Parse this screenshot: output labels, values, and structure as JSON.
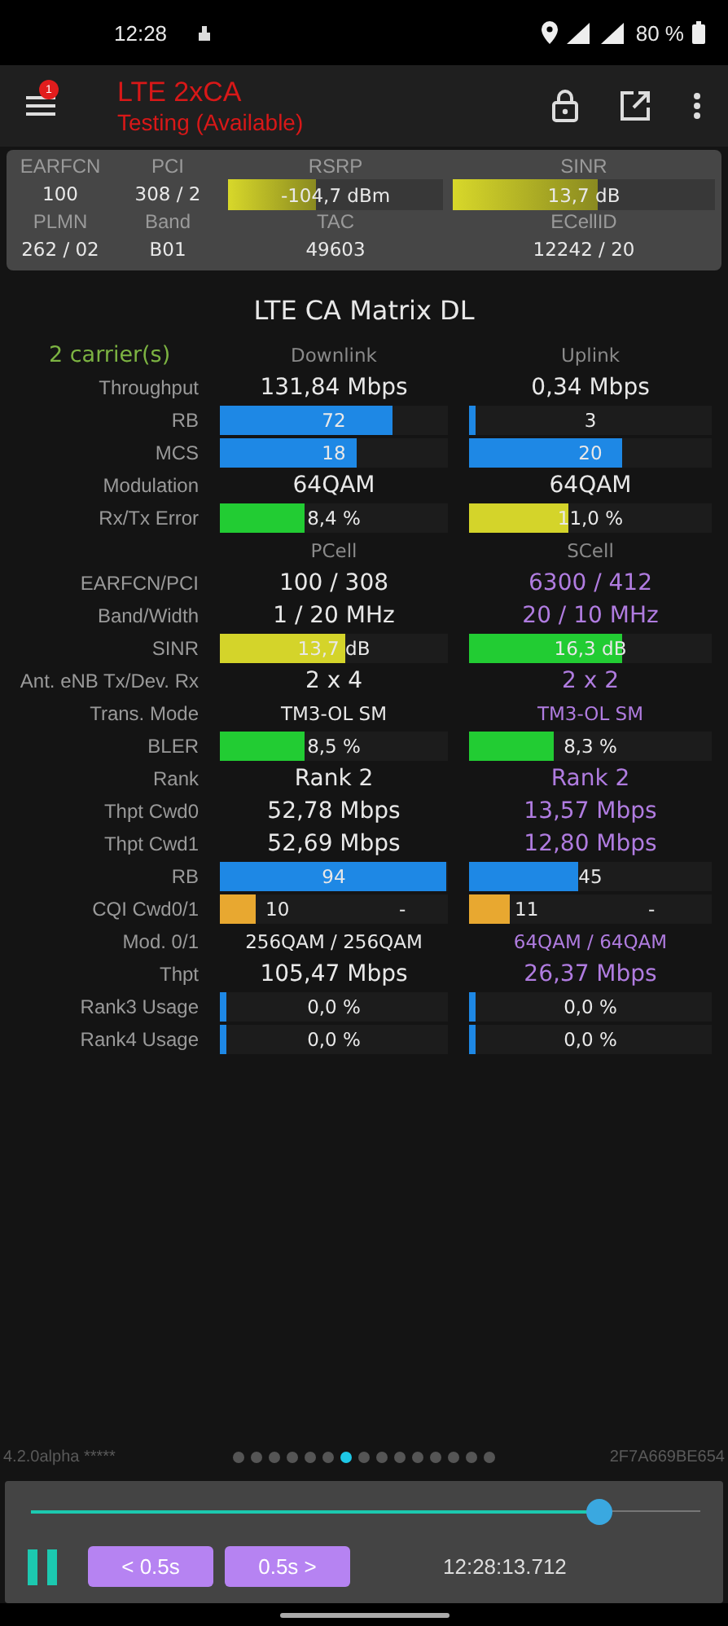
{
  "status_bar": {
    "time": "12:28",
    "battery": "80 %"
  },
  "app_bar": {
    "badge": "1",
    "title": "LTE 2xCA",
    "subtitle": "Testing (Available)"
  },
  "info_panel": {
    "row1": [
      {
        "label": "EARFCN",
        "value": "100",
        "kind": "text"
      },
      {
        "label": "PCI",
        "value": "308 / 2",
        "kind": "text"
      },
      {
        "label": "RSRP",
        "value": "-104,7 dBm",
        "kind": "bar",
        "level": 0.41
      },
      {
        "label": "SINR",
        "value": "13,7 dB",
        "kind": "bar",
        "level": 0.55
      }
    ],
    "row2": [
      {
        "label": "PLMN",
        "value": "262 / 02"
      },
      {
        "label": "Band",
        "value": "B01"
      },
      {
        "label": "TAC",
        "value": "49603"
      },
      {
        "label": "ECellID",
        "value": "12242 / 20"
      }
    ]
  },
  "matrix": {
    "title": "LTE CA Matrix DL",
    "rows": [
      {
        "kind": "header",
        "label": "2 carrier(s)",
        "cells": [
          {
            "text": "Downlink"
          },
          {
            "text": "Uplink"
          }
        ]
      },
      {
        "kind": "value",
        "label": "Throughput",
        "cells": [
          {
            "text": "131,84 Mbps",
            "color": "#e8e8e8"
          },
          {
            "text": "0,34 Mbps",
            "color": "#e8e8e8"
          }
        ]
      },
      {
        "kind": "bar",
        "label": "RB",
        "cells": [
          {
            "text": "72",
            "level": 0.76,
            "color": "#1e88e5"
          },
          {
            "text": "3",
            "level": 0.02,
            "color": "#1e88e5"
          }
        ]
      },
      {
        "kind": "bar",
        "label": "MCS",
        "cells": [
          {
            "text": "18",
            "level": 0.6,
            "color": "#1e88e5"
          },
          {
            "text": "20",
            "level": 0.63,
            "color": "#1e88e5"
          }
        ]
      },
      {
        "kind": "value",
        "label": "Modulation",
        "cells": [
          {
            "text": "64QAM",
            "color": "#e8e8e8"
          },
          {
            "text": "64QAM",
            "color": "#e8e8e8"
          }
        ]
      },
      {
        "kind": "bar",
        "label": "Rx/Tx Error",
        "cells": [
          {
            "text": "8,4 %",
            "level": 0.37,
            "color": "#22cc33"
          },
          {
            "text": "11,0 %",
            "level": 0.41,
            "color": "#d4d42a"
          }
        ]
      },
      {
        "kind": "header",
        "cells": [
          {
            "text": "PCell"
          },
          {
            "text": "SCell"
          }
        ]
      },
      {
        "kind": "value",
        "label": "EARFCN/PCI",
        "cells": [
          {
            "text": "100 / 308",
            "color": "#e8e8e8"
          },
          {
            "text": "6300 / 412",
            "color": "#b07ce0"
          }
        ]
      },
      {
        "kind": "value",
        "label": "Band/Width",
        "cells": [
          {
            "text": "1 / 20 MHz",
            "color": "#e8e8e8"
          },
          {
            "text": "20 / 10 MHz",
            "color": "#b07ce0"
          }
        ]
      },
      {
        "kind": "bar",
        "label": "SINR",
        "cells": [
          {
            "text": "13,7 dB",
            "level": 0.55,
            "color": "#d4d42a"
          },
          {
            "text": "16,3 dB",
            "level": 0.63,
            "color": "#22cc33"
          }
        ]
      },
      {
        "kind": "value",
        "label": "Ant. eNB Tx/Dev. Rx",
        "cells": [
          {
            "text": "2 x 4",
            "color": "#e8e8e8"
          },
          {
            "text": "2 x 2",
            "color": "#b07ce0"
          }
        ]
      },
      {
        "kind": "small",
        "label": "Trans. Mode",
        "cells": [
          {
            "text": "TM3-OL SM",
            "color": "#e8e8e8"
          },
          {
            "text": "TM3-OL SM",
            "color": "#b07ce0"
          }
        ]
      },
      {
        "kind": "bar",
        "label": "BLER",
        "cells": [
          {
            "text": "8,5 %",
            "level": 0.37,
            "color": "#22cc33"
          },
          {
            "text": "8,3 %",
            "level": 0.35,
            "color": "#22cc33"
          }
        ]
      },
      {
        "kind": "value",
        "label": "Rank",
        "cells": [
          {
            "text": "Rank 2",
            "color": "#e8e8e8"
          },
          {
            "text": "Rank 2",
            "color": "#b07ce0"
          }
        ]
      },
      {
        "kind": "value",
        "label": "Thpt Cwd0",
        "cells": [
          {
            "text": "52,78 Mbps",
            "color": "#e8e8e8"
          },
          {
            "text": "13,57 Mbps",
            "color": "#b07ce0"
          }
        ]
      },
      {
        "kind": "value",
        "label": "Thpt Cwd1",
        "cells": [
          {
            "text": "52,69 Mbps",
            "color": "#e8e8e8"
          },
          {
            "text": "12,80 Mbps",
            "color": "#b07ce0"
          }
        ]
      },
      {
        "kind": "bar",
        "label": "RB",
        "cells": [
          {
            "text": "94",
            "level": 0.99,
            "color": "#1e88e5"
          },
          {
            "text": "45",
            "level": 0.45,
            "color": "#1e88e5"
          }
        ]
      },
      {
        "kind": "cqi",
        "label": "CQI Cwd0/1",
        "cells": [
          {
            "text": "10",
            "text2": "-",
            "level": 0.16,
            "color": "#e8a830"
          },
          {
            "text": "11",
            "text2": "-",
            "level": 0.17,
            "color": "#e8a830"
          }
        ]
      },
      {
        "kind": "small",
        "label": "Mod. 0/1",
        "cells": [
          {
            "text": "256QAM / 256QAM",
            "color": "#e8e8e8"
          },
          {
            "text": "64QAM / 64QAM",
            "color": "#b07ce0"
          }
        ]
      },
      {
        "kind": "value",
        "label": "Thpt",
        "cells": [
          {
            "text": "105,47 Mbps",
            "color": "#e8e8e8"
          },
          {
            "text": "26,37 Mbps",
            "color": "#b07ce0"
          }
        ]
      },
      {
        "kind": "bar",
        "label": "Rank3 Usage",
        "cells": [
          {
            "text": "0,0 %",
            "level": 0.02,
            "color": "#1e88e5"
          },
          {
            "text": "0,0 %",
            "level": 0.02,
            "color": "#1e88e5"
          }
        ]
      },
      {
        "kind": "bar",
        "label": "Rank4 Usage",
        "cells": [
          {
            "text": "0,0 %",
            "level": 0.02,
            "color": "#1e88e5"
          },
          {
            "text": "0,0 %",
            "level": 0.02,
            "color": "#1e88e5"
          }
        ]
      }
    ]
  },
  "footer": {
    "version": "4.2.0alpha *****",
    "device_id": "2F7A669BE654",
    "pages": [
      {
        "selected": false
      },
      {
        "selected": false
      },
      {
        "selected": false
      },
      {
        "selected": false
      },
      {
        "selected": false
      },
      {
        "selected": false
      },
      {
        "selected": true
      },
      {
        "selected": false
      },
      {
        "selected": false
      },
      {
        "selected": false
      },
      {
        "selected": false
      },
      {
        "selected": false
      },
      {
        "selected": false
      },
      {
        "selected": false
      },
      {
        "selected": false
      }
    ]
  },
  "player": {
    "level": 0.85,
    "playing": true,
    "buttons": [
      "< 0.5s",
      "0.5s >"
    ],
    "timestamp": "12:28:13.712"
  }
}
